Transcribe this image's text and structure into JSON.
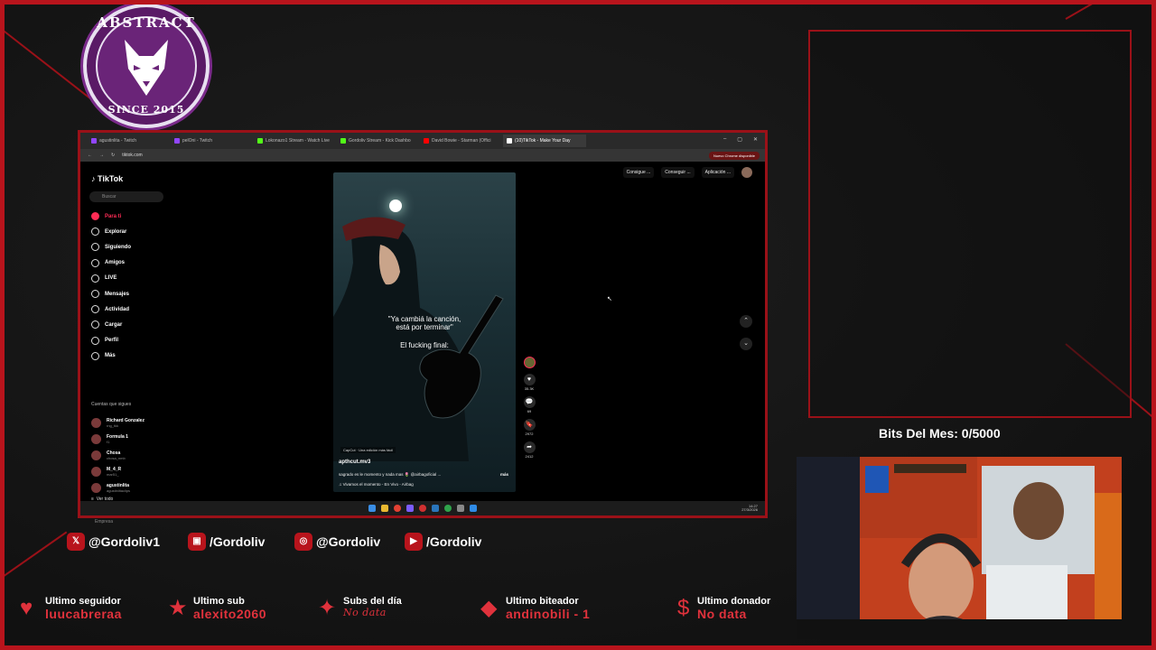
{
  "logo": {
    "top_text": "ABSTRACT",
    "bottom_text": "SINCE 2015"
  },
  "browser": {
    "tabs": [
      {
        "label": "agustinlita - Twitch",
        "color": "#9146ff"
      },
      {
        "label": "pelOni - Twitch",
        "color": "#9146ff"
      },
      {
        "label": "Lokonazo1 Stream - Watch Live",
        "color": "#53fc18"
      },
      {
        "label": "Gordoliv Stream - Kick Dashbo",
        "color": "#53fc18"
      },
      {
        "label": "David Bowie - Starman (Offici",
        "color": "#ff0000"
      },
      {
        "label": "(10)TikTok - Make Your Day",
        "color": "#ffffff"
      }
    ],
    "url": "tiktok.com",
    "chrome_update": "Nuevo Chrome disponible",
    "window_controls": [
      "–",
      "▢",
      "✕"
    ]
  },
  "tiktok": {
    "brand": "TikTok",
    "search_placeholder": "Buscar",
    "nav": [
      "Para ti",
      "Explorar",
      "Siguiendo",
      "Amigos",
      "LIVE",
      "Mensajes",
      "Actividad",
      "Cargar",
      "Perfil",
      "Más"
    ],
    "following_title": "Cuentas que sigues",
    "following": [
      {
        "name": "Richard Gonzalez",
        "handle": "rng_tkk"
      },
      {
        "name": "Formula 1",
        "handle": "f1"
      },
      {
        "name": "Chosa",
        "handle": "chosa_nmb"
      },
      {
        "name": "M_4_R",
        "handle": "mar51_"
      },
      {
        "name": "agustinlita",
        "handle": "agustinlitaclips"
      }
    ],
    "see_all": "Ver todo",
    "footer": "Empresa",
    "top_buttons": [
      "Consigue ...",
      "Conseguir ...",
      "Aplicación ..."
    ],
    "video": {
      "caption_line1": "\"Ya cambiá la canción,",
      "caption_line2": "está por terminar\"",
      "caption_line3": "El fucking final:",
      "capcut": "CapCut · Una edición más fácil",
      "user": "apthcut.mv3",
      "description": "sagrado es le momento y nada mas 🌷 @airbagoficial ...",
      "more": "más",
      "song": "♫ Vivamos el momento - En Vivo - Airbag"
    },
    "actions": [
      {
        "icon": "♥",
        "count": "35.3K"
      },
      {
        "icon": "💬",
        "count": "69"
      },
      {
        "icon": "🔖",
        "count": "2972"
      },
      {
        "icon": "➦",
        "count": "2412"
      }
    ],
    "tray_time": "14:27",
    "tray_date": "27/3/2026",
    "tray_lang": "ESP LAA"
  },
  "overlay": {
    "bits": "Bits Del Mes:  0/5000",
    "socials": [
      {
        "icon": "twitter",
        "label": "@Gordoliv1"
      },
      {
        "icon": "twitch",
        "label": "/Gordoliv"
      },
      {
        "icon": "instagram",
        "label": "@Gordoliv"
      },
      {
        "icon": "youtube",
        "label": "/Gordoliv"
      }
    ],
    "stats": [
      {
        "label": "Ultimo seguidor",
        "value": "luucabreraa"
      },
      {
        "label": "Ultimo sub",
        "value": "alexito2060"
      },
      {
        "label": "Subs del día",
        "value": "No data"
      },
      {
        "label": "Ultimo biteador",
        "value": "andinobili - 1"
      },
      {
        "label": "Ultimo donador",
        "value": "No data"
      }
    ]
  },
  "colors": {
    "accent": "#b8141c",
    "tiktok_red": "#fe2c55"
  }
}
